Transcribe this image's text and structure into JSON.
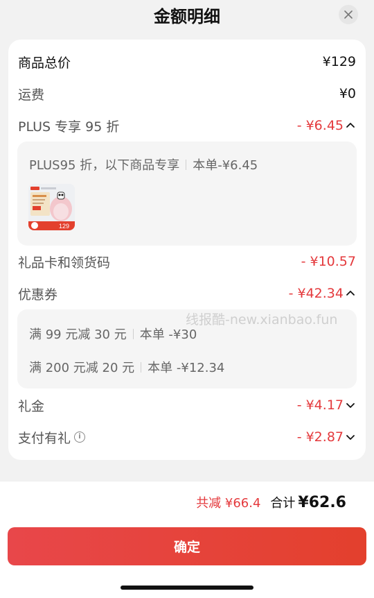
{
  "header": {
    "title": "金额明细",
    "close_icon": "close-icon"
  },
  "rows": {
    "goods_total": {
      "label": "商品总价",
      "value": "¥129"
    },
    "shipping": {
      "label": "运费",
      "value": "¥0"
    },
    "plus": {
      "label": "PLUS 专享 95 折",
      "value": "- ¥6.45",
      "chevron": "chevron-up-icon"
    },
    "gift_card": {
      "label": "礼品卡和领货码",
      "value": "- ¥10.57"
    },
    "coupon": {
      "label": "优惠券",
      "value": "- ¥42.34",
      "chevron": "chevron-up-icon"
    },
    "cash_gift": {
      "label": "礼金",
      "value": "- ¥4.17",
      "chevron": "chevron-down-icon"
    },
    "pay_gift": {
      "label": "支付有礼",
      "value": "- ¥2.87",
      "chevron": "chevron-down-icon",
      "info_icon": "i"
    }
  },
  "plus_panel": {
    "desc": "PLUS95 折，以下商品专享",
    "detail": "本单-¥6.45",
    "product_price_tag": "129"
  },
  "coupon_panel": {
    "items": [
      {
        "rule": "满 99 元减 30 元",
        "detail": "本单 -¥30"
      },
      {
        "rule": "满 200 元减 20 元",
        "detail": "本单 -¥12.34"
      }
    ]
  },
  "watermark": "线报酷-new.xianbao.fun",
  "footer": {
    "saved": "共减 ¥66.4",
    "total_label": "合计",
    "total_value": "¥62.6",
    "confirm_label": "确定"
  },
  "colors": {
    "accent_red": "#e4393c",
    "button_start": "#e8474a",
    "button_end": "#e3402d"
  }
}
